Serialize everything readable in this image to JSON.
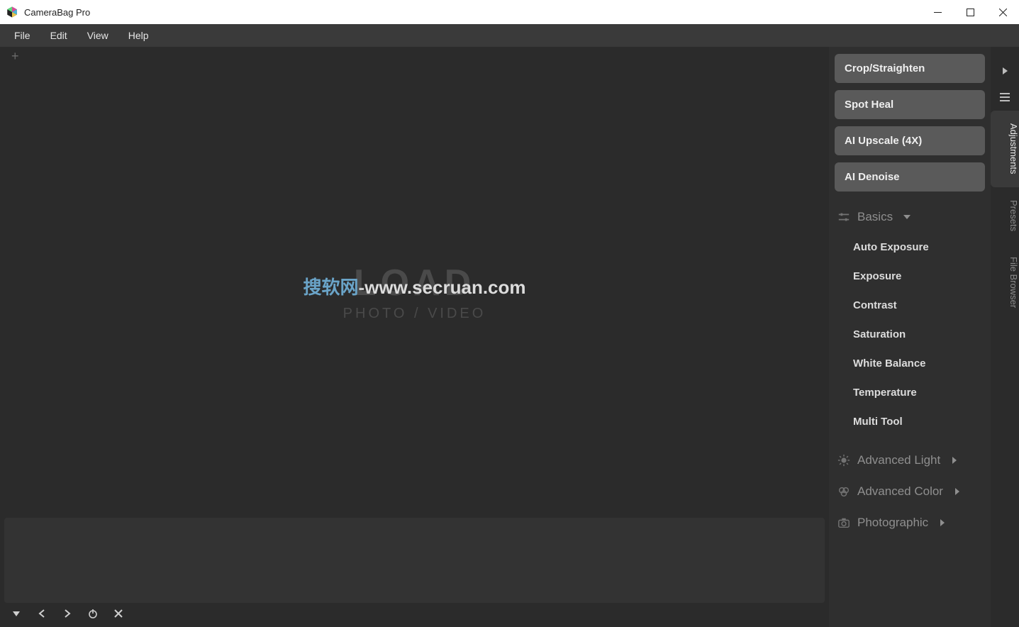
{
  "window": {
    "title": "CameraBag Pro"
  },
  "menubar": {
    "items": [
      "File",
      "Edit",
      "View",
      "Help"
    ]
  },
  "canvas": {
    "load_title": "LOAD",
    "load_sub": "PHOTO / VIDEO",
    "watermark_cn": "搜软网",
    "watermark_dash": "-",
    "watermark_en": "www.secruan.com"
  },
  "adjust_buttons": [
    "Crop/Straighten",
    "Spot Heal",
    "AI Upscale (4X)",
    "AI Denoise"
  ],
  "sections": {
    "basics": {
      "label": "Basics",
      "expanded": true,
      "items": [
        "Auto Exposure",
        "Exposure",
        "Contrast",
        "Saturation",
        "White Balance",
        "Temperature",
        "Multi Tool"
      ]
    },
    "adv_light": {
      "label": "Advanced Light",
      "expanded": false
    },
    "adv_color": {
      "label": "Advanced Color",
      "expanded": false
    },
    "photographic": {
      "label": "Photographic",
      "expanded": false
    }
  },
  "rail": {
    "tabs": [
      "Adjustments",
      "Presets",
      "File Browser"
    ],
    "active_index": 0
  }
}
